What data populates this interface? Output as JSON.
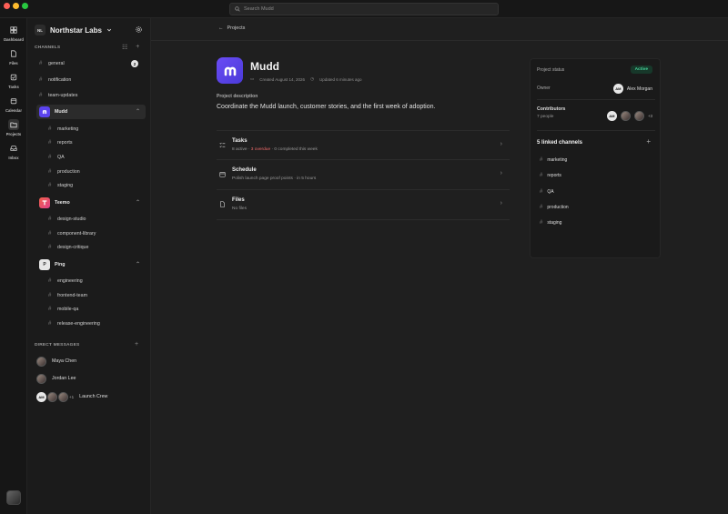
{
  "search": {
    "placeholder": "Search Mudd"
  },
  "rail": [
    {
      "label": "Dashboard",
      "icon": "dashboard-icon"
    },
    {
      "label": "Files",
      "icon": "file-icon"
    },
    {
      "label": "Tasks",
      "icon": "tasks-icon"
    },
    {
      "label": "Calendar",
      "icon": "calendar-icon"
    },
    {
      "label": "Projects",
      "icon": "folder-icon"
    },
    {
      "label": "Inbox",
      "icon": "inbox-icon"
    }
  ],
  "workspace": {
    "initials": "NL",
    "name": "Northstar Labs"
  },
  "sidebar": {
    "channels_heading": "CHANNELS",
    "channels": [
      {
        "name": "general",
        "badge": "2"
      },
      {
        "name": "notification"
      },
      {
        "name": "team-updates"
      }
    ],
    "projects": [
      {
        "name": "Mudd",
        "channels": [
          "marketing",
          "reports",
          "QA",
          "production",
          "staging"
        ]
      },
      {
        "name": "Teemo",
        "channels": [
          "design-studio",
          "component-library",
          "design-critique"
        ]
      },
      {
        "name": "Ping",
        "initial": "P",
        "channels": [
          "engineering",
          "frontend-team",
          "mobile-qa",
          "release-engineering"
        ]
      }
    ],
    "dm_heading": "DIRECT MESSAGES",
    "dms": [
      {
        "name": "Maya Chen"
      },
      {
        "name": "Jordan Lee"
      },
      {
        "name": "Launch Crew",
        "am": "AM",
        "extra": "+1"
      }
    ]
  },
  "main": {
    "breadcrumb": "Projects",
    "title": "Mudd",
    "created": "Created August 14, 2026",
    "updated": "Updated 6 minutes ago",
    "desc_label": "Project description",
    "description": "Coordinate the Mudd launch, customer stories, and the first week of adoption.",
    "rows": [
      {
        "title": "Tasks",
        "sub_a": "8 active · ",
        "sub_warn": "3 overdue",
        "sub_b": " · 0 completed this week"
      },
      {
        "title": "Schedule",
        "sub_a": "Polish launch page proof points · in 5 hours",
        "sub_warn": "",
        "sub_b": ""
      },
      {
        "title": "Files",
        "sub_a": "No files",
        "sub_warn": "",
        "sub_b": ""
      }
    ]
  },
  "panel": {
    "status_label": "Project status",
    "status_value": "Active",
    "owner_label": "Owner",
    "owner_initials": "AM",
    "owner_name": "Alex Morgan",
    "contributors_label": "Contributors",
    "contributors_count": "7 people",
    "contributors_extra": "+3",
    "linked_title": "5 linked channels",
    "linked": [
      "marketing",
      "reports",
      "QA",
      "production",
      "staging"
    ]
  },
  "colors": {
    "accent": "#5b43ee",
    "teemo": "#f0604a",
    "active_green": "#46d49a",
    "overdue": "#f06a6a"
  }
}
